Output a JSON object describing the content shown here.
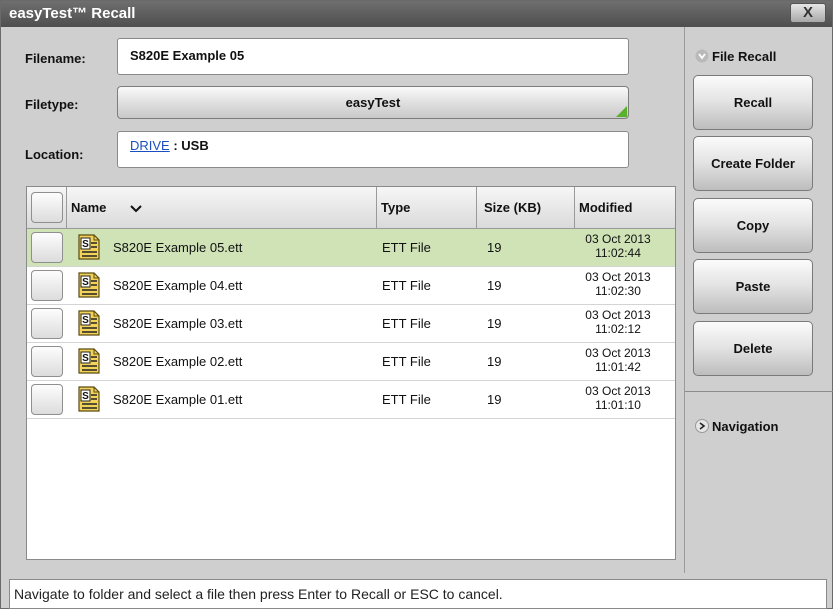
{
  "window": {
    "title": "easyTest™ Recall",
    "close_symbol": "X"
  },
  "form": {
    "filename_label": "Filename:",
    "filename_value": "S820E Example 05",
    "filetype_label": "Filetype:",
    "filetype_value": "easyTest",
    "location_label": "Location:",
    "location_link": "DRIVE",
    "location_rest": " : USB"
  },
  "table": {
    "headers": {
      "name": "Name",
      "sort_icon": "chevron-down-icon",
      "type": "Type",
      "size": "Size (KB)",
      "modified": "Modified"
    },
    "rows": [
      {
        "name": "S820E Example 05.ett",
        "type": "ETT File",
        "size": "19",
        "date": "03 Oct 2013",
        "time": "11:02:44",
        "selected": true
      },
      {
        "name": "S820E Example 04.ett",
        "type": "ETT File",
        "size": "19",
        "date": "03 Oct 2013",
        "time": "11:02:30",
        "selected": false
      },
      {
        "name": "S820E Example 03.ett",
        "type": "ETT File",
        "size": "19",
        "date": "03 Oct 2013",
        "time": "11:02:12",
        "selected": false
      },
      {
        "name": "S820E Example 02.ett",
        "type": "ETT File",
        "size": "19",
        "date": "03 Oct 2013",
        "time": "11:01:42",
        "selected": false
      },
      {
        "name": "S820E Example 01.ett",
        "type": "ETT File",
        "size": "19",
        "date": "03 Oct 2013",
        "time": "11:01:10",
        "selected": false
      }
    ]
  },
  "sidebar": {
    "file_recall_label": "File Recall",
    "buttons": [
      "Recall",
      "Create Folder",
      "Copy",
      "Paste",
      "Delete"
    ],
    "navigation_label": "Navigation"
  },
  "status": {
    "message": "Navigate to folder and select a file then press Enter to Recall or ESC to cancel."
  },
  "colors": {
    "selected_row": "#cfe3b7",
    "accent_green": "#59b02c",
    "titlebar": "#5a5a5a"
  }
}
